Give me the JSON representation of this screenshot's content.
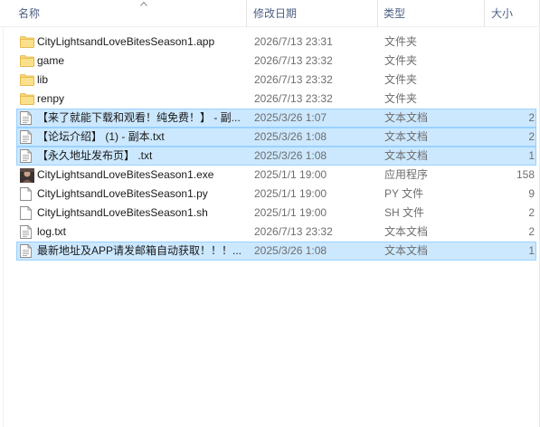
{
  "columns": {
    "name": "名称",
    "date": "修改日期",
    "type": "类型",
    "size": "大小"
  },
  "colors": {
    "selected_bg": "#cce8ff",
    "selected_border": "#99d1ff",
    "header_text": "#4d6082",
    "folder": "#f8d775"
  },
  "files": [
    {
      "name": "CityLightsandLoveBitesSeason1.app",
      "date": "2026/7/13 23:31",
      "type": "文件夹",
      "size": "",
      "icon": "folder-icon",
      "selected": false
    },
    {
      "name": "game",
      "date": "2026/7/13 23:32",
      "type": "文件夹",
      "size": "",
      "icon": "folder-icon",
      "selected": false
    },
    {
      "name": "lib",
      "date": "2026/7/13 23:32",
      "type": "文件夹",
      "size": "",
      "icon": "folder-icon",
      "selected": false
    },
    {
      "name": "renpy",
      "date": "2026/7/13 23:32",
      "type": "文件夹",
      "size": "",
      "icon": "folder-icon",
      "selected": false
    },
    {
      "name": "【来了就能下载和观看！纯免费！】 - 副...",
      "date": "2025/3/26 1:07",
      "type": "文本文档",
      "size": "2",
      "icon": "text-file-icon",
      "selected": true
    },
    {
      "name": "【论坛介绍】 (1) - 副本.txt",
      "date": "2025/3/26 1:08",
      "type": "文本文档",
      "size": "2",
      "icon": "text-file-icon",
      "selected": true
    },
    {
      "name": "【永久地址发布页】 .txt",
      "date": "2025/3/26 1:08",
      "type": "文本文档",
      "size": "1",
      "icon": "text-file-icon",
      "selected": true
    },
    {
      "name": "CityLightsandLoveBitesSeason1.exe",
      "date": "2025/1/1 19:00",
      "type": "应用程序",
      "size": "158",
      "icon": "app-image-icon",
      "selected": false
    },
    {
      "name": "CityLightsandLoveBitesSeason1.py",
      "date": "2025/1/1 19:00",
      "type": "PY 文件",
      "size": "9",
      "icon": "file-icon",
      "selected": false
    },
    {
      "name": "CityLightsandLoveBitesSeason1.sh",
      "date": "2025/1/1 19:00",
      "type": "SH 文件",
      "size": "2",
      "icon": "file-icon",
      "selected": false
    },
    {
      "name": "log.txt",
      "date": "2026/7/13 23:32",
      "type": "文本文档",
      "size": "2",
      "icon": "text-file-icon",
      "selected": false
    },
    {
      "name": "最新地址及APP请发邮箱自动获取！！！...",
      "date": "2025/3/26 1:08",
      "type": "文本文档",
      "size": "1",
      "icon": "text-file-icon",
      "selected": true
    }
  ]
}
